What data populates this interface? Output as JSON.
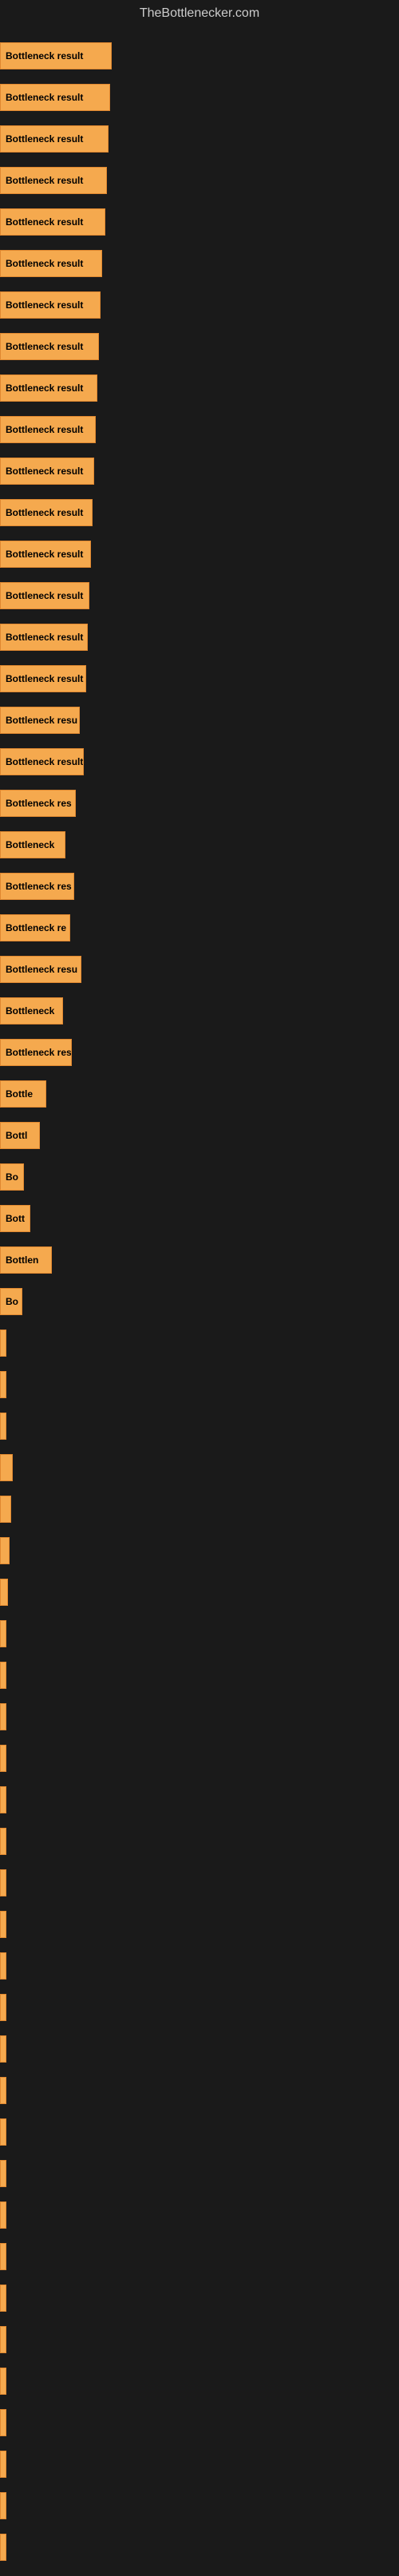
{
  "site": {
    "title": "TheBottlenecker.com"
  },
  "bars": [
    {
      "label": "Bottleneck result",
      "width": 140
    },
    {
      "label": "Bottleneck result",
      "width": 138
    },
    {
      "label": "Bottleneck result",
      "width": 136
    },
    {
      "label": "Bottleneck result",
      "width": 134
    },
    {
      "label": "Bottleneck result",
      "width": 132
    },
    {
      "label": "Bottleneck result",
      "width": 128
    },
    {
      "label": "Bottleneck result",
      "width": 126
    },
    {
      "label": "Bottleneck result",
      "width": 124
    },
    {
      "label": "Bottleneck result",
      "width": 122
    },
    {
      "label": "Bottleneck result",
      "width": 120
    },
    {
      "label": "Bottleneck result",
      "width": 118
    },
    {
      "label": "Bottleneck result",
      "width": 116
    },
    {
      "label": "Bottleneck result",
      "width": 114
    },
    {
      "label": "Bottleneck result",
      "width": 112
    },
    {
      "label": "Bottleneck result",
      "width": 110
    },
    {
      "label": "Bottleneck result",
      "width": 108
    },
    {
      "label": "Bottleneck resu",
      "width": 100
    },
    {
      "label": "Bottleneck result",
      "width": 105
    },
    {
      "label": "Bottleneck res",
      "width": 95
    },
    {
      "label": "Bottleneck",
      "width": 82
    },
    {
      "label": "Bottleneck res",
      "width": 93
    },
    {
      "label": "Bottleneck re",
      "width": 88
    },
    {
      "label": "Bottleneck resu",
      "width": 102
    },
    {
      "label": "Bottleneck",
      "width": 79
    },
    {
      "label": "Bottleneck res",
      "width": 90
    },
    {
      "label": "Bottle",
      "width": 58
    },
    {
      "label": "Bottl",
      "width": 50
    },
    {
      "label": "Bo",
      "width": 30
    },
    {
      "label": "Bott",
      "width": 38
    },
    {
      "label": "Bottlen",
      "width": 65
    },
    {
      "label": "Bo",
      "width": 28
    },
    {
      "label": "|",
      "width": 8
    },
    {
      "label": "",
      "width": 4
    },
    {
      "label": "|",
      "width": 6
    },
    {
      "label": "",
      "width": 16
    },
    {
      "label": "",
      "width": 14
    },
    {
      "label": "",
      "width": 12
    },
    {
      "label": "",
      "width": 10
    },
    {
      "label": "",
      "width": 8
    },
    {
      "label": "",
      "width": 6
    },
    {
      "label": "",
      "width": 4
    },
    {
      "label": "",
      "width": 2
    },
    {
      "label": "",
      "width": 5
    },
    {
      "label": "",
      "width": 3
    },
    {
      "label": "",
      "width": 6
    },
    {
      "label": "",
      "width": 4
    },
    {
      "label": "",
      "width": 2
    },
    {
      "label": "",
      "width": 1
    },
    {
      "label": "",
      "width": 3
    },
    {
      "label": "",
      "width": 2
    },
    {
      "label": "",
      "width": 1
    },
    {
      "label": "",
      "width": 4
    },
    {
      "label": "",
      "width": 3
    },
    {
      "label": "",
      "width": 2
    },
    {
      "label": "",
      "width": 1
    },
    {
      "label": "",
      "width": 2
    },
    {
      "label": "",
      "width": 1
    },
    {
      "label": "",
      "width": 1
    },
    {
      "label": "",
      "width": 1
    },
    {
      "label": "",
      "width": 1
    },
    {
      "label": "",
      "width": 2
    }
  ]
}
